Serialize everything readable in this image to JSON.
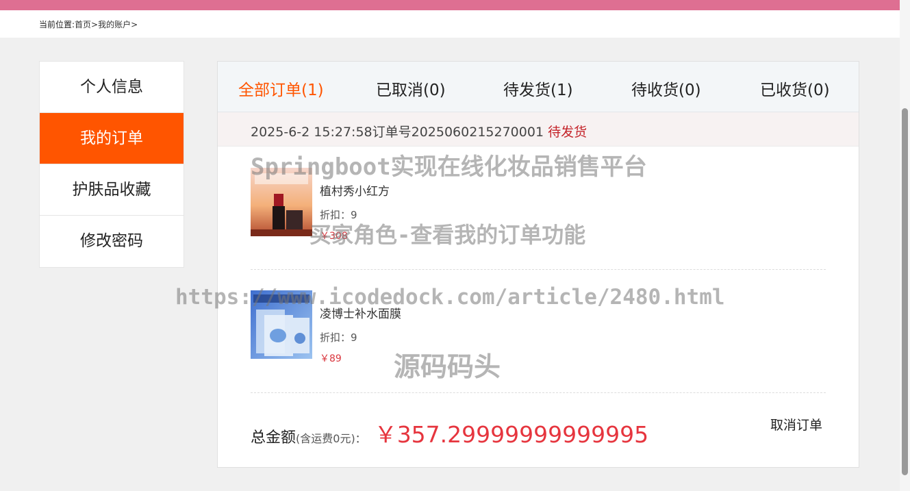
{
  "breadcrumb": {
    "label": "当前位置:",
    "path": "首页>我的账户>"
  },
  "sidebar": {
    "items": [
      {
        "label": "个人信息"
      },
      {
        "label": "我的订单"
      },
      {
        "label": "护肤品收藏"
      },
      {
        "label": "修改密码"
      }
    ],
    "active_color": "#ff5500"
  },
  "tabs": [
    {
      "label": "全部订单(1)"
    },
    {
      "label": "已取消(0)"
    },
    {
      "label": "待发货(1)"
    },
    {
      "label": "待收货(0)"
    },
    {
      "label": "已收货(0)"
    }
  ],
  "order": {
    "time_and_no": "2025-6-2 15:27:58订单号2025060215270001",
    "status": "待发货",
    "items": [
      {
        "name": "植村秀小红方",
        "discount": "折扣：9",
        "price": "￥308"
      },
      {
        "name": "凌博士补水面膜",
        "discount": "折扣：9",
        "price": "￥89"
      }
    ],
    "total_label": "总金额",
    "total_note": "(含运费0元)：",
    "total_value": "￥357.29999999999995",
    "cancel_label": "取消订单"
  },
  "watermarks": {
    "title": "Springboot实现在线化妆品销售平台",
    "subtitle": "买家角色-查看我的订单功能",
    "url": "https://www.icodedock.com/article/2480.html",
    "brand": "源码码头"
  },
  "colors": {
    "topbar": "#de6f92",
    "accent": "#ff5500",
    "price": "#e6353e"
  }
}
